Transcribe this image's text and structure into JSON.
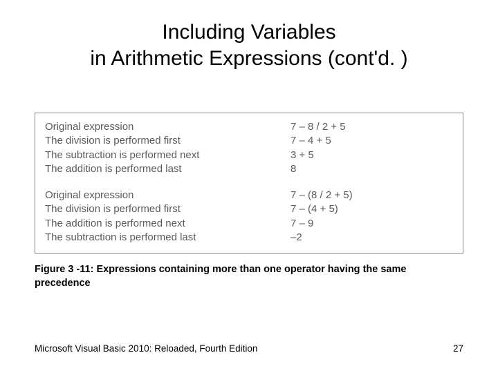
{
  "title_line1": "Including Variables",
  "title_line2": "in Arithmetic Expressions (cont'd. )",
  "groups": [
    {
      "rows": [
        {
          "desc": "Original expression",
          "expr": "7 – 8 / 2 + 5"
        },
        {
          "desc": "The division is performed first",
          "expr": "7 – 4 + 5"
        },
        {
          "desc": "The subtraction is performed next",
          "expr": "3 + 5"
        },
        {
          "desc": "The addition is performed last",
          "expr": "8"
        }
      ]
    },
    {
      "rows": [
        {
          "desc": "Original expression",
          "expr": "7 – (8 / 2 + 5)"
        },
        {
          "desc": "The division is performed first",
          "expr": "7 – (4 + 5)"
        },
        {
          "desc": "The addition is performed next",
          "expr": "7 – 9"
        },
        {
          "desc": "The subtraction is performed last",
          "expr": "–2"
        }
      ]
    }
  ],
  "caption": "Figure 3 -11: Expressions containing more than one operator having the same precedence",
  "footer_left": "Microsoft Visual Basic 2010: Reloaded, Fourth Edition",
  "footer_right": "27"
}
